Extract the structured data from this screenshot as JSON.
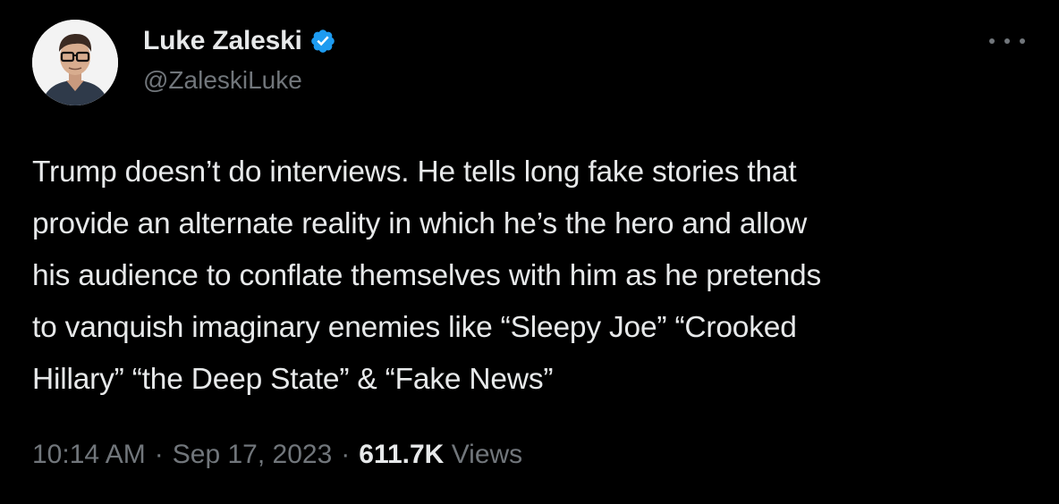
{
  "author": {
    "display_name": "Luke Zaleski",
    "handle": "@ZaleskiLuke",
    "verified": true
  },
  "tweet": {
    "text": "Trump doesn’t do interviews. He tells long fake stories that\nprovide an alternate reality in which he’s the hero and allow\nhis audience to conflate themselves with him as he pretends\nto vanquish imaginary enemies like “Sleepy Joe” “Crooked\nHillary” “the Deep State” & “Fake News”"
  },
  "meta": {
    "time": "10:14 AM",
    "separator": "·",
    "date": "Sep 17, 2023",
    "views_count": "611.7K",
    "views_label": "Views"
  },
  "colors": {
    "background": "#000000",
    "primary_text": "#e7e9ea",
    "secondary_text": "#71767b",
    "verified_badge": "#1d9bf0"
  },
  "icons": {
    "verified": "verified-badge-icon",
    "more": "more-options-icon"
  }
}
